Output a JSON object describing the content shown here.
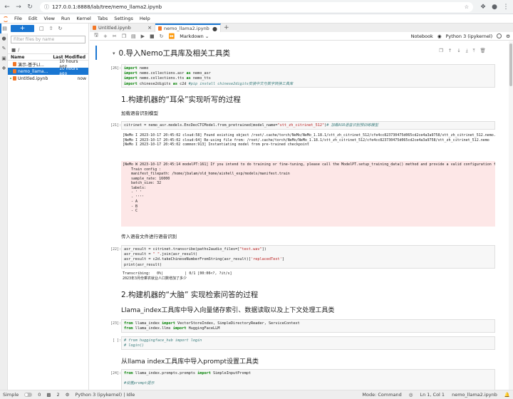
{
  "browser": {
    "url": "127.0.0.1:8888/lab/tree/nemo_llama2.ipynb"
  },
  "menubar": [
    "File",
    "Edit",
    "View",
    "Run",
    "Kernel",
    "Tabs",
    "Settings",
    "Help"
  ],
  "filebrowser": {
    "filter_placeholder": "Filter files by name",
    "crumb": "/",
    "col_name": "Name",
    "col_modified": "Last Modified",
    "files": [
      {
        "name": "演示-基于Ll...",
        "modified": "10 hours ago",
        "selected": false
      },
      {
        "name": "nemo_llama...",
        "modified": "10 hours ago",
        "selected": true
      },
      {
        "name": "Untitled.ipynb",
        "modified": "now",
        "selected": false
      }
    ]
  },
  "tabs": [
    {
      "label": "Untitled.ipynb",
      "active": false
    },
    {
      "label": "nemo_llama2.ipynb",
      "active": true
    }
  ],
  "toolbar": {
    "cell_type": "Markdown",
    "notebook_label": "Notebook",
    "kernel": "Python 3 (ipykernel)"
  },
  "cells": {
    "h_tools": "0.导入Nemo工具库及相关工具类",
    "c1_prompt": "[26]:",
    "c1_code": "import nemo\nimport nemo.collections.asr as nemo_asr\nimport nemo.collections.tts as nemo_tts\nimport chinese2digits as c2d #pip install chinese2digits安装中文与数字转换工具库",
    "h_ear": "1.构建机器的“耳朵”实现听写的过程",
    "p_load": "加载语音识别模型",
    "c2_prompt": "[21]:",
    "c2_code": "citrinet = nemo_asr.models.EncDecCTCModel.from_pretrained(model_name=\"stt_zh_citrinet_512\")# 加载ASR语音识别预训练模型",
    "c2_out1": "[NeMo I 2023-10-17 20:45:02 cloud:58] Found existing object /root/.cache/torch/NeMo/NeMo_1.18.1/stt_zh_citrinet_512/cfe4cc823730475d065cd2ce4a3a9758/stt_zh_citrinet_512.nemo.\n[NeMo I 2023-10-17 20:45:02 cloud:64] Re-using file from: /root/.cache/torch/NeMo/NeMo_1.18.1/stt_zh_citrinet_512/cfe4cc823730475d065cd2ce4a3a9758/stt_zh_citrinet_512.nemo\n[NeMo I 2023-10-17 20:45:02 common:913] Instantiating model from pre-trained checkpoint",
    "c2_out2": "[NeMo W 2023-10-17 20:45:14 modelPT:161] If you intend to do training or fine-tuning, please call the ModelPT.setup_training_data() method and provide a valid configuration file to setup the train data loader.\n    Train config :\n    manifest_filepath: /home/jbalam/old_home/aishell_exp/models/manifest.train\n    sample_rate: 16000\n    batch_size: 32\n    labels:\n    - ' '\n    - ''''\n    - A\n    - B\n    - C",
    "p_audio": "传入语音文件进行语音识别",
    "c3_prompt": "[22]:",
    "c3_code": "asr_result = citrinet.transcribe(paths2audio_files=[\"test.wav\"])\nasr_result = \" \".join(asr_result)\nasr_result = c2d.takeChineseNumberFromString(asr_result)['replacedText']\nprint(asr_result)",
    "c3_out": "Transcribing:   0%|          | 0/1 [00:00<?, ?it/s]\n2023年3月份乘农就业人口数增加了多少",
    "h_brain": "2.构建机器的“大脑” 实现检索问答的过程",
    "h_llama": "Llama_index工具库中导入向量储存索引、数据读取以及上下文处理工具类",
    "c4_prompt": "[23]:",
    "c4_code": "from llama_index import VectorStoreIndex, SimpleDirectoryReader, ServiceContext\nfrom llama_index.llms import HuggingFaceLLM",
    "c5_prompt": "[ ]:",
    "c5_code": "# from huggingface_hub import login\n# login()",
    "h_prompt": "从llama index工具库中导入prompt设置工具类",
    "c6_prompt": "[24]:",
    "c6_code": "from llama_index.prompts.prompts import SimpleInputPrompt\n\n#设置prompt提示"
  },
  "status": {
    "mode_label": "Simple",
    "count_a": "0",
    "count_b": "2",
    "kernel_status": "Python 3 (ipykernel) | Idle",
    "mode": "Mode: Command",
    "position": "Ln 1, Col 1",
    "file": "nemo_llama2.ipynb"
  }
}
